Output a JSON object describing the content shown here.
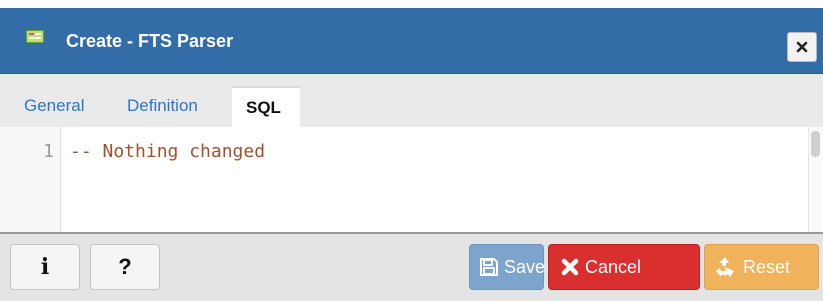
{
  "dialog": {
    "title": "Create - FTS Parser",
    "title_icon": "fts-parser-icon",
    "close_icon": "close-icon"
  },
  "tabs": [
    {
      "label": "General",
      "active": false
    },
    {
      "label": "Definition",
      "active": false
    },
    {
      "label": "SQL",
      "active": true
    }
  ],
  "editor": {
    "lines": [
      {
        "number": "1",
        "text": "-- Nothing changed"
      }
    ]
  },
  "footer": {
    "info_label": "i",
    "help_label": "?",
    "save_label": "Save",
    "cancel_label": "Cancel",
    "reset_label": "Reset"
  },
  "colors": {
    "titlebar": "#326da8",
    "save": "#7da4cc",
    "cancel": "#d9302f",
    "reset": "#f0b35b",
    "tab_link": "#2c76c4",
    "sql_comment": "#a0522d"
  }
}
